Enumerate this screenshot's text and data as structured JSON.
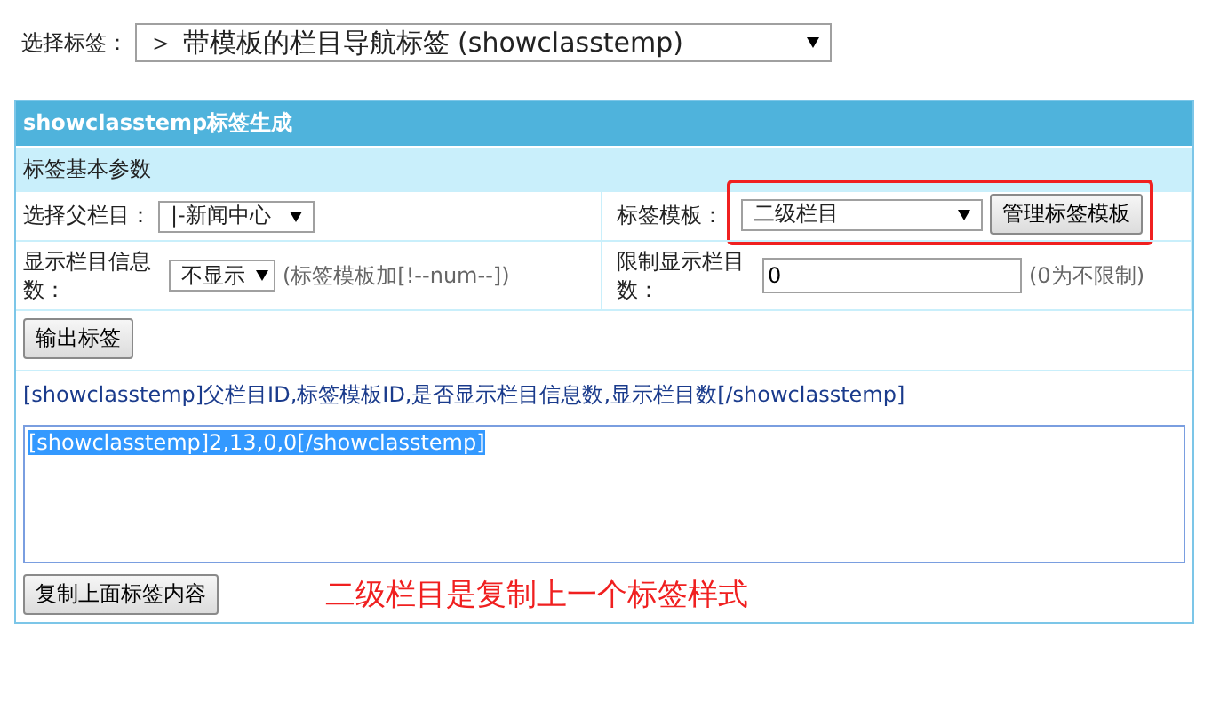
{
  "tag_select": {
    "label": "选择标签：",
    "value": "＞ 带模板的栏目导航标签 (showclasstemp)"
  },
  "panel": {
    "title": "showclasstemp标签生成",
    "section": "标签基本参数",
    "parent_label": "选择父栏目：",
    "parent_value": "|-新闻中心",
    "template_label": "标签模板：",
    "template_value": "二级栏目",
    "manage_button": "管理标签模板",
    "count_label": "显示栏目信息数：",
    "count_value": "不显示",
    "count_hint": "(标签模板加[!--num--])",
    "limit_label": "限制显示栏目数：",
    "limit_value": "0",
    "limit_hint": "(0为不限制)",
    "output_button": "输出标签",
    "syntax": "[showclasstemp]父栏目ID,标签模板ID,是否显示栏目信息数,显示栏目数[/showclasstemp]",
    "code": "[showclasstemp]2,13,0,0[/showclasstemp]",
    "copy_button": "复制上面标签内容",
    "annotation": "二级栏目是复制上一个标签样式"
  }
}
